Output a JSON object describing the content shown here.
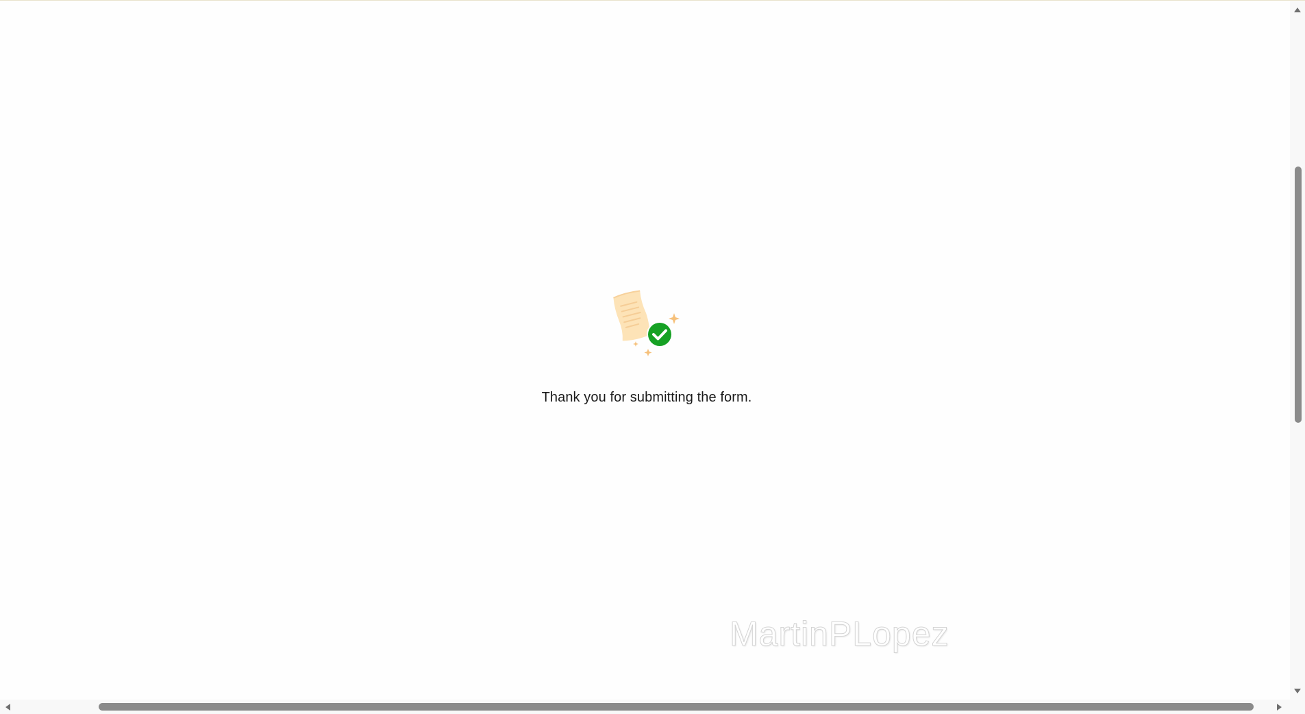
{
  "confirmation": {
    "message": "Thank you for submitting the form.",
    "illustration_icon": "document-check-icon",
    "check_color": "#16a124",
    "paper_color": "#fde3b7",
    "sparkle_color": "#f6c07a"
  },
  "watermark": {
    "text": "MartinPLopez"
  },
  "scrollbars": {
    "vertical_icon_up": "chevron-up-icon",
    "vertical_icon_down": "chevron-down-icon",
    "horizontal_icon_left": "chevron-left-icon",
    "horizontal_icon_right": "chevron-right-icon"
  }
}
